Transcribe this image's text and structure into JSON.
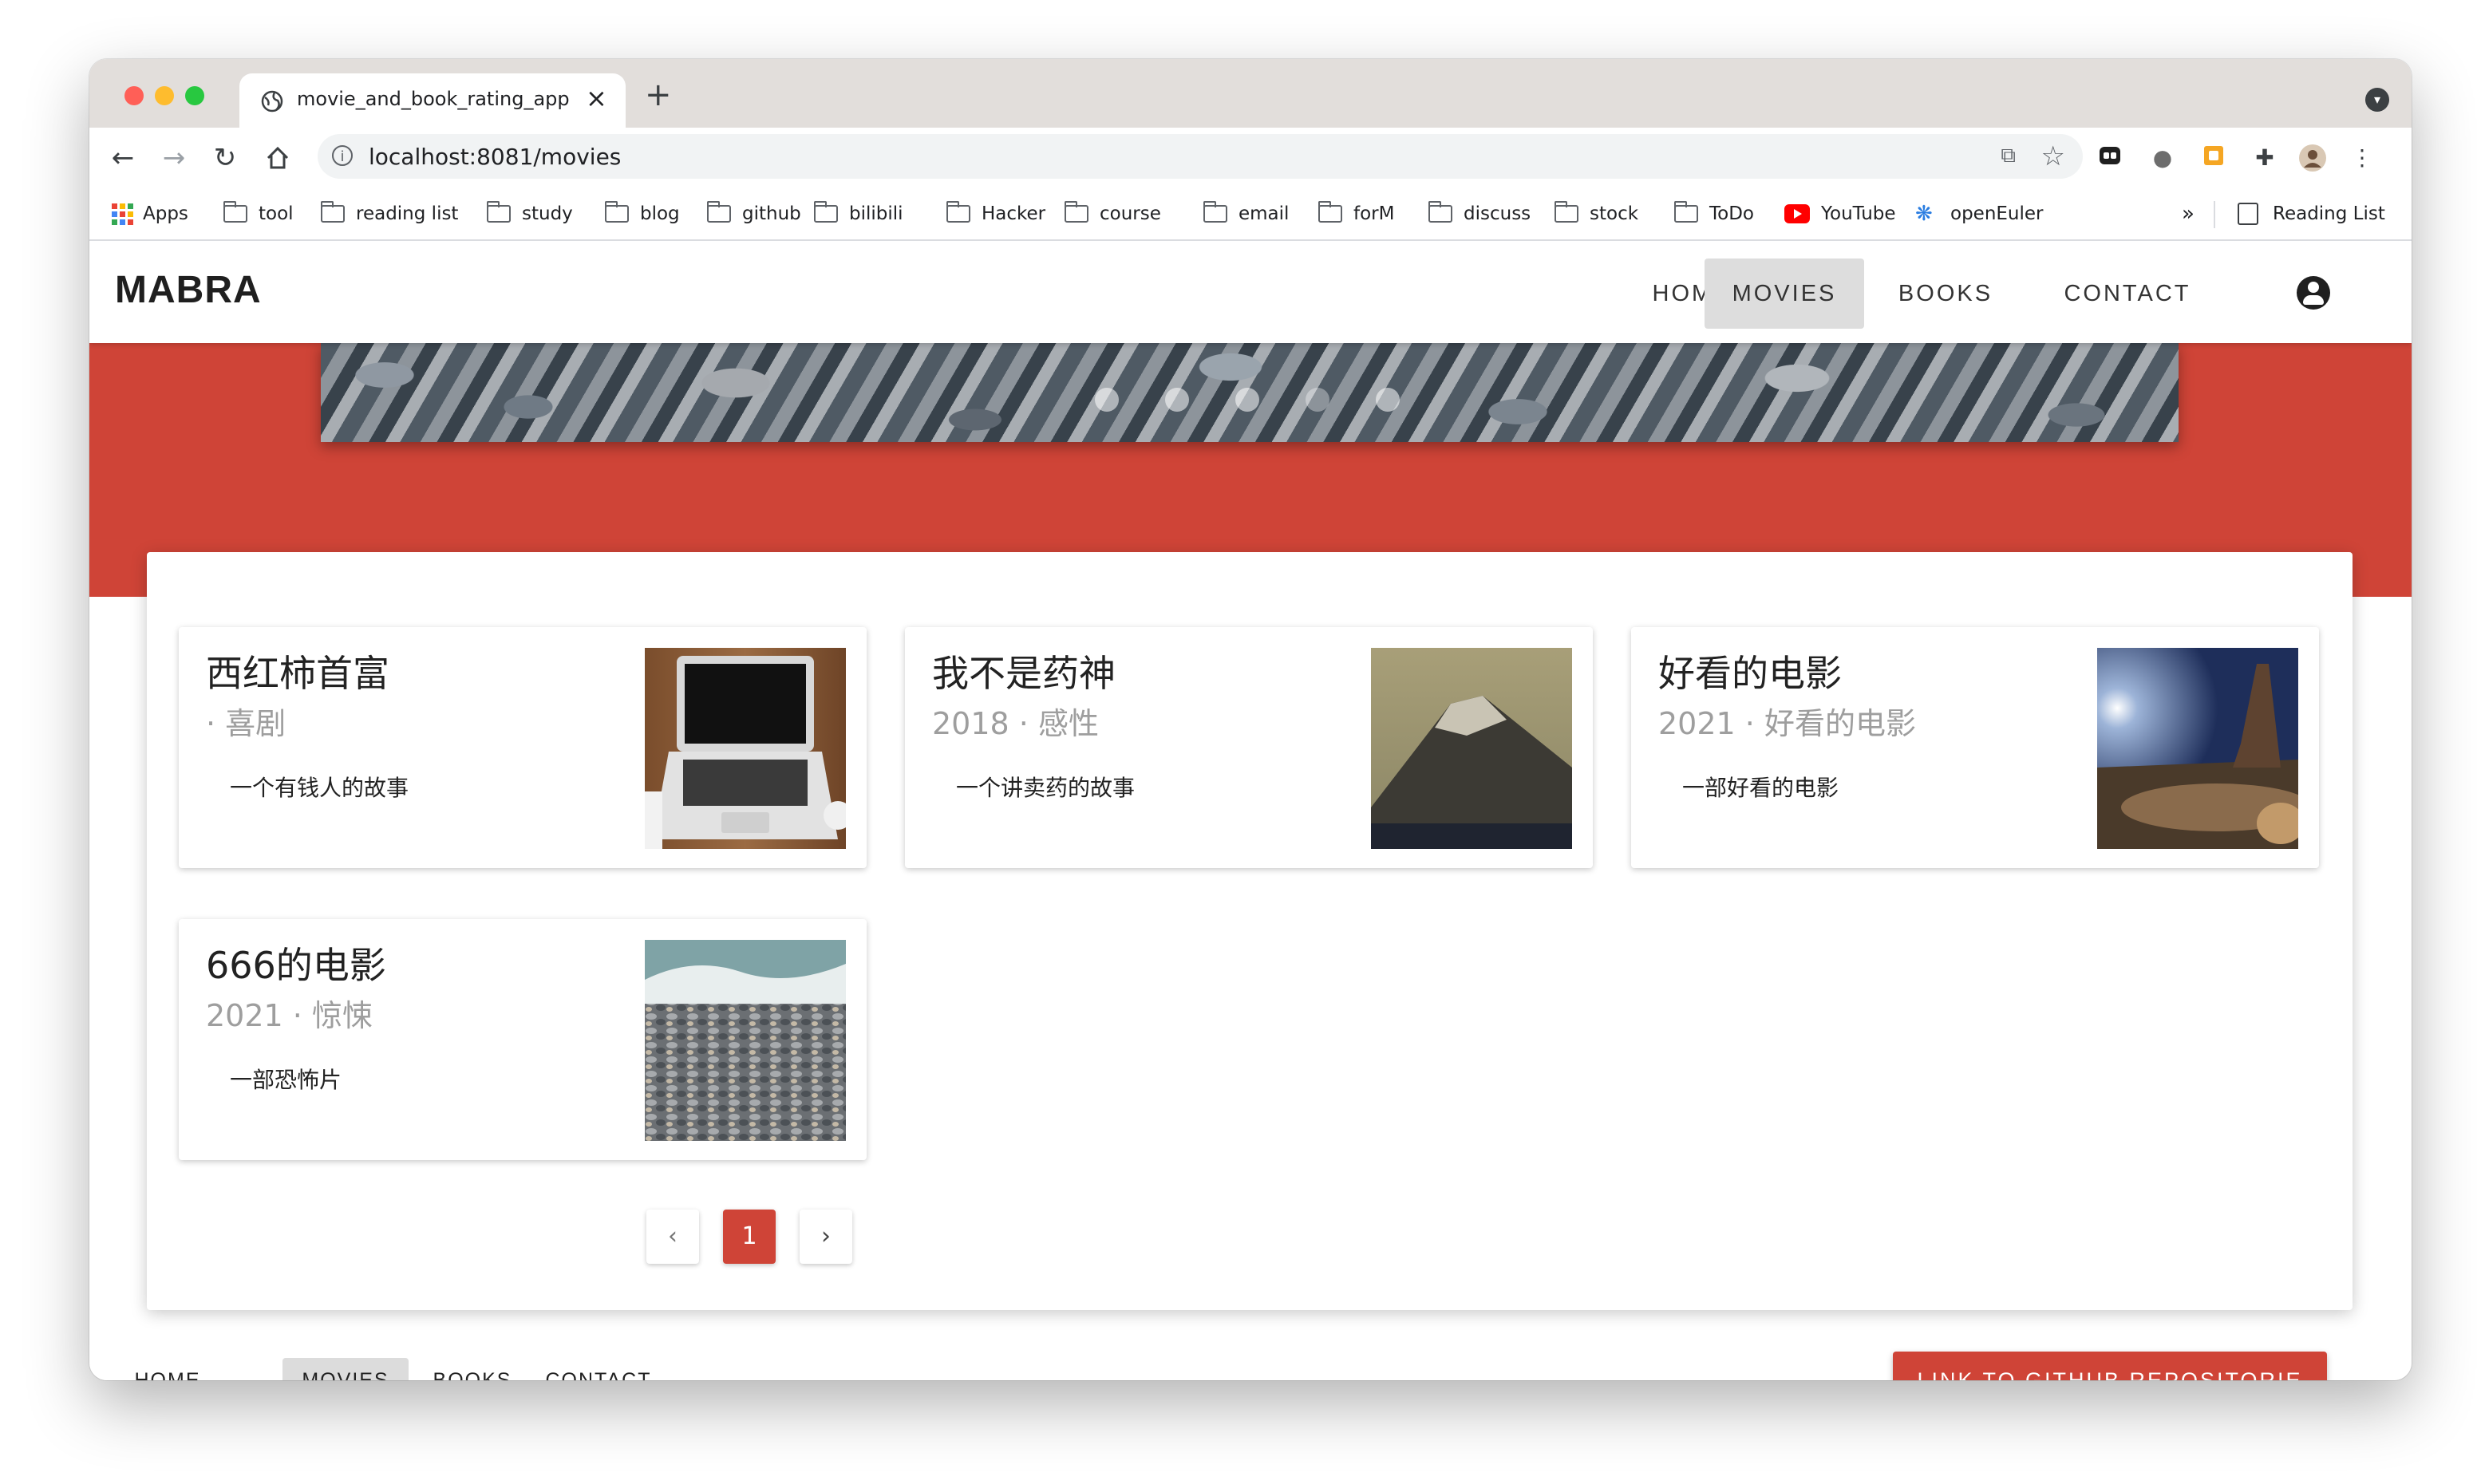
{
  "browser": {
    "tab_title": "movie_and_book_rating_app",
    "url": "localhost:8081/movies",
    "bookmarks": [
      {
        "label": "Apps",
        "kind": "apps"
      },
      {
        "label": "tool",
        "kind": "folder"
      },
      {
        "label": "reading list",
        "kind": "folder"
      },
      {
        "label": "study",
        "kind": "folder"
      },
      {
        "label": "blog",
        "kind": "folder"
      },
      {
        "label": "github",
        "kind": "folder"
      },
      {
        "label": "bilibili",
        "kind": "folder"
      },
      {
        "label": "Hacker",
        "kind": "folder"
      },
      {
        "label": "course",
        "kind": "folder"
      },
      {
        "label": "email",
        "kind": "folder"
      },
      {
        "label": "forM",
        "kind": "folder"
      },
      {
        "label": "discuss",
        "kind": "folder"
      },
      {
        "label": "stock",
        "kind": "folder"
      },
      {
        "label": "ToDo",
        "kind": "folder"
      },
      {
        "label": "YouTube",
        "kind": "youtube"
      },
      {
        "label": "openEuler",
        "kind": "openeuler"
      }
    ],
    "overflow_label": "»",
    "reading_list_label": "Reading List"
  },
  "app": {
    "brand": "MABRA",
    "nav": [
      {
        "label": "HOME",
        "active": false
      },
      {
        "label": "MOVIES",
        "active": true
      },
      {
        "label": "BOOKS",
        "active": false
      },
      {
        "label": "CONTACT",
        "active": false
      }
    ],
    "accent_color": "#cf4437",
    "movies": [
      {
        "title": "西红柿首富",
        "subtitle": "· 喜剧",
        "description": "一个有钱人的故事",
        "image": "laptop"
      },
      {
        "title": "我不是药神",
        "subtitle": "2018 · 感性",
        "description": "一个讲卖药的故事",
        "image": "mountain"
      },
      {
        "title": "好看的电影",
        "subtitle": "2021 · 好看的电影",
        "description": "一部好看的电影",
        "image": "night-desert"
      },
      {
        "title": "666的电影",
        "subtitle": "2021 · 惊悚",
        "description": "一部恐怖片",
        "image": "pebble-beach"
      }
    ],
    "pagination": {
      "prev": "‹",
      "current": "1",
      "next": "›"
    },
    "footer": {
      "nav": [
        {
          "label": "HOME",
          "active": false
        },
        {
          "label": "MOVIES",
          "active": true
        },
        {
          "label": "BOOKS",
          "active": false
        },
        {
          "label": "CONTACT",
          "active": false
        }
      ],
      "github_button": "LINK TO GITHUB REPOSITORIE"
    }
  }
}
